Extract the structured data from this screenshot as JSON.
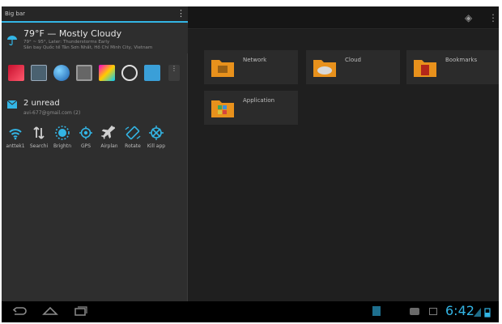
{
  "shade": {
    "title": "Big bar",
    "weather": {
      "headline": "79°F — Mostly Cloudy",
      "detail1": "79° ~ 95°, Later: Thunderstorms Early",
      "detail2": "Sân bay Quốc tế Tân Sơn Nhất, Hồ Chí Minh City, Vietnam"
    },
    "mail": {
      "headline": "2 unread",
      "account": "avi-677@gmail.com (2)"
    },
    "toggles": [
      {
        "label": "anttek1",
        "icon": "wifi-icon"
      },
      {
        "label": "Searchi",
        "icon": "data-sync-icon"
      },
      {
        "label": "Brightn",
        "icon": "brightness-icon"
      },
      {
        "label": "GPS",
        "icon": "gps-icon"
      },
      {
        "label": "Airplan",
        "icon": "airplane-icon"
      },
      {
        "label": "Rotate",
        "icon": "rotate-icon"
      },
      {
        "label": "Kill app",
        "icon": "kill-app-icon"
      }
    ]
  },
  "tiles": [
    {
      "label": "Network"
    },
    {
      "label": "Cloud"
    },
    {
      "label": "Bookmarks"
    },
    {
      "label": "Application"
    }
  ],
  "status": {
    "time": "6:42"
  },
  "colors": {
    "accent": "#33b5e5",
    "folder": "#e8911c"
  }
}
